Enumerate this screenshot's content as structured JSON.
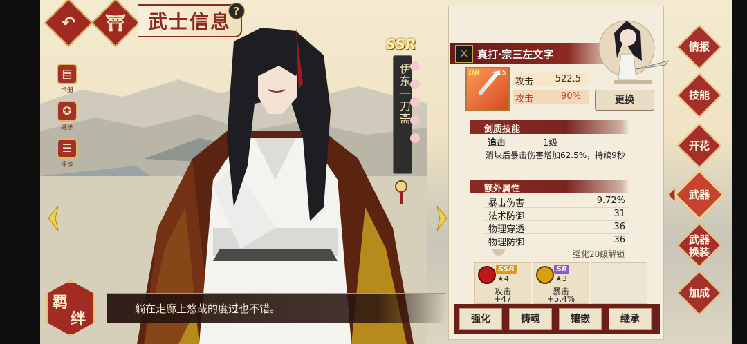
{
  "header": {
    "title": "武士信息",
    "back_icon": "back-arrow-icon",
    "home_icon": "torii-home-icon",
    "help_label": "?"
  },
  "side_tools": [
    {
      "label": "卡册",
      "icon": "card-album-icon"
    },
    {
      "label": "继承",
      "icon": "star-emblem-icon"
    },
    {
      "label": "评价",
      "icon": "review-icon"
    }
  ],
  "character": {
    "rarity": "SSR",
    "name": "伊东一刀斋"
  },
  "dialogue": {
    "text": "躺在走廊上悠哉的度过也不错。"
  },
  "kizuna": {
    "label_1": "羁",
    "label_2": "绊"
  },
  "weapon": {
    "name": "真打·宗三左文字",
    "rarity": "UR",
    "level": "+15",
    "stats": [
      {
        "label": "攻击",
        "value": "522.5"
      },
      {
        "label": "攻击",
        "value": "90%"
      }
    ],
    "change_label": "更换"
  },
  "skill": {
    "section": "剑质技能",
    "name": "追击",
    "level": "1级",
    "desc": "消块后暴击伤害增加62.5%，持续9秒"
  },
  "extra": {
    "section": "额外属性",
    "attributes": [
      {
        "label": "暴击伤害",
        "value": "9.72%"
      },
      {
        "label": "法术防御",
        "value": "31"
      },
      {
        "label": "物理穿透",
        "value": "36"
      },
      {
        "label": "物理防御",
        "value": "36"
      }
    ],
    "unlock_hint": "强化20级解锁"
  },
  "gems": [
    {
      "rank": "SSR",
      "stars": "4",
      "stat": "攻击",
      "value": "+47",
      "color": "#c0181a"
    },
    {
      "rank": "SR",
      "stars": "3",
      "stat": "暴击",
      "value": "+5.4%",
      "color": "#d8a010"
    }
  ],
  "actions": [
    "强化",
    "铸魂",
    "镶嵌",
    "继承"
  ],
  "nav": [
    {
      "label": "情报"
    },
    {
      "label": "技能"
    },
    {
      "label": "开花"
    },
    {
      "label": "武器"
    },
    {
      "label_1": "武器",
      "label_2": "换装"
    },
    {
      "label": "加成"
    }
  ],
  "colors": {
    "accent_red": "#a5302a",
    "gold": "#e7c68a",
    "panel": "#f4ecdc"
  }
}
